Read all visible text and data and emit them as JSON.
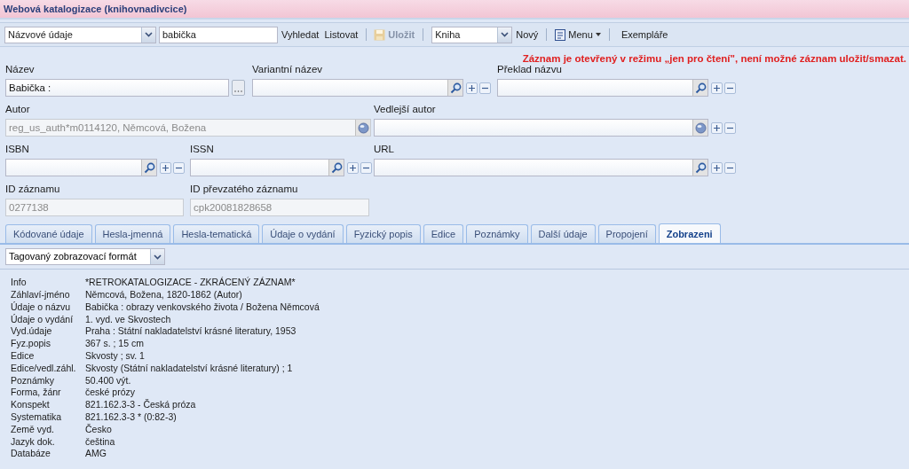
{
  "window": {
    "title": "Webová katalogizace (knihovnadivcice)"
  },
  "toolbar": {
    "search_field": "Názvové údaje",
    "query": "babička",
    "search_button": "Vyhledat",
    "browse_button": "Listovat",
    "save_button": {
      "label": "Uložit",
      "disabled": true
    },
    "doc_type": "Kniha",
    "new_button": "Nový",
    "menu_button": "Menu",
    "items_button": "Exempláře"
  },
  "notice": "Záznam je otevřený v režimu „jen pro čtení\", není možné záznam uložit/smazat.",
  "form_rows": [
    [
      {
        "label": "Název",
        "value": "Babička :",
        "disabled": false,
        "kind": "ellipsis",
        "multi": false
      },
      {
        "label": "Variantní název",
        "disabled": false,
        "kind": "search",
        "multi": true
      },
      {
        "label": "Překlad názvu",
        "disabled": false,
        "kind": "search",
        "multi": true
      }
    ],
    [
      {
        "label": "Autor",
        "value": "reg_us_auth*m0114120, Němcová, Božena",
        "disabled": true,
        "kind": "globe",
        "multi": false
      },
      {
        "label": "Vedlejší autor",
        "disabled": false,
        "kind": "globe",
        "multi": true
      }
    ],
    [
      {
        "label": "ISBN",
        "disabled": false,
        "kind": "search",
        "multi": true
      },
      {
        "label": "ISSN",
        "disabled": false,
        "kind": "search",
        "multi": true
      },
      {
        "label": "URL",
        "disabled": false,
        "kind": "search",
        "multi": true
      }
    ],
    [
      {
        "label": "ID záznamu",
        "value": "0277138",
        "disabled": true,
        "kind": "plain",
        "multi": false
      },
      {
        "label": "ID převzatého záznamu",
        "value": "cpk20081828658",
        "disabled": true,
        "kind": "plain",
        "multi": false
      }
    ]
  ],
  "tabs": [
    {
      "label": "Kódované údaje",
      "selected": false
    },
    {
      "label": "Hesla-jmenná",
      "selected": false
    },
    {
      "label": "Hesla-tematická",
      "selected": false
    },
    {
      "label": "Údaje o vydání",
      "selected": false
    },
    {
      "label": "Fyzický popis",
      "selected": false
    },
    {
      "label": "Edice",
      "selected": false
    },
    {
      "label": "Poznámky",
      "selected": false
    },
    {
      "label": "Další údaje",
      "selected": false
    },
    {
      "label": "Propojení",
      "selected": false
    },
    {
      "label": "Zobrazeni",
      "selected": true
    }
  ],
  "format_select": "Tagovaný zobrazovací formát",
  "record": [
    {
      "tag": "Info",
      "value": "*RETROKATALOGIZACE - ZKRÁCENÝ ZÁZNAM*"
    },
    {
      "tag": "Záhlaví-jméno",
      "value": "Němcová, Božena, 1820-1862 (Autor)"
    },
    {
      "tag": "Údaje o názvu",
      "value": "Babička : obrazy venkovského života / Božena Němcová"
    },
    {
      "tag": "Údaje o vydání",
      "value": "1. vyd. ve Skvostech"
    },
    {
      "tag": "Vyd.údaje",
      "value": "Praha : Státní nakladatelství krásné literatury, 1953"
    },
    {
      "tag": "Fyz.popis",
      "value": "367 s. ; 15 cm"
    },
    {
      "tag": "Edice",
      "value": "Skvosty ; sv. 1"
    },
    {
      "tag": "Edice/vedl.záhl.",
      "value": "Skvosty (Státní nakladatelství krásné literatury) ; 1"
    },
    {
      "tag": "Poznámky",
      "value": "50.400 výt."
    },
    {
      "tag": "Forma, žánr",
      "value": "české prózy"
    },
    {
      "tag": "Konspekt",
      "value": "821.162.3-3 - Česká próza"
    },
    {
      "tag": "Systematika",
      "value": "821.162.3-3 * (0:82-3)"
    },
    {
      "tag": "Země vyd.",
      "value": "Česko"
    },
    {
      "tag": "Jazyk dok.",
      "value": "čeština"
    },
    {
      "tag": "Databáze",
      "value": "AMG"
    }
  ]
}
